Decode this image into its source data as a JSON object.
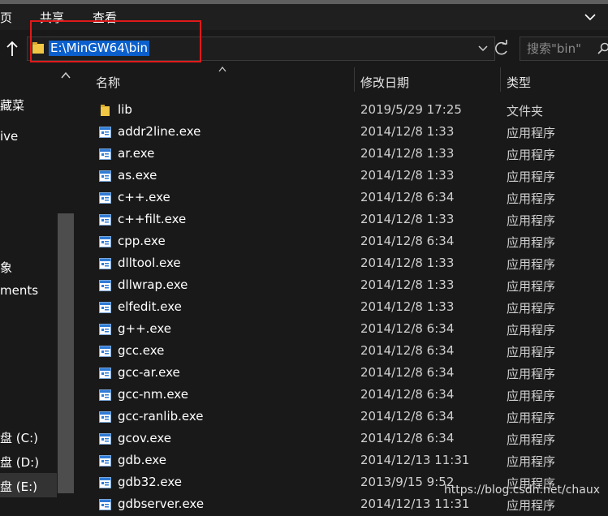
{
  "ribbon": {
    "tabs": [
      "页",
      "共享",
      "查看"
    ]
  },
  "address": {
    "path": "E:\\MinGW64\\bin"
  },
  "search": {
    "placeholder": "搜索\"bin\""
  },
  "nav": {
    "items": [
      "藏菜",
      "ive",
      "象",
      "ments",
      "盘 (C:)",
      "盘 (D:)",
      "盘 (E:)"
    ]
  },
  "columns": {
    "name": "名称",
    "modified": "修改日期",
    "type": "类型"
  },
  "files": [
    {
      "name": "lib",
      "modified": "2019/5/29 17:25",
      "type": "文件夹",
      "icon": "folder-icon"
    },
    {
      "name": "addr2line.exe",
      "modified": "2014/12/8 1:33",
      "type": "应用程序",
      "icon": "exe-icon"
    },
    {
      "name": "ar.exe",
      "modified": "2014/12/8 1:33",
      "type": "应用程序",
      "icon": "exe-icon"
    },
    {
      "name": "as.exe",
      "modified": "2014/12/8 1:33",
      "type": "应用程序",
      "icon": "exe-icon"
    },
    {
      "name": "c++.exe",
      "modified": "2014/12/8 6:34",
      "type": "应用程序",
      "icon": "exe-icon"
    },
    {
      "name": "c++filt.exe",
      "modified": "2014/12/8 1:33",
      "type": "应用程序",
      "icon": "exe-icon"
    },
    {
      "name": "cpp.exe",
      "modified": "2014/12/8 6:34",
      "type": "应用程序",
      "icon": "exe-icon"
    },
    {
      "name": "dlltool.exe",
      "modified": "2014/12/8 1:33",
      "type": "应用程序",
      "icon": "exe-icon"
    },
    {
      "name": "dllwrap.exe",
      "modified": "2014/12/8 1:33",
      "type": "应用程序",
      "icon": "exe-icon"
    },
    {
      "name": "elfedit.exe",
      "modified": "2014/12/8 1:33",
      "type": "应用程序",
      "icon": "exe-icon"
    },
    {
      "name": "g++.exe",
      "modified": "2014/12/8 6:34",
      "type": "应用程序",
      "icon": "exe-icon"
    },
    {
      "name": "gcc.exe",
      "modified": "2014/12/8 6:34",
      "type": "应用程序",
      "icon": "exe-icon"
    },
    {
      "name": "gcc-ar.exe",
      "modified": "2014/12/8 6:34",
      "type": "应用程序",
      "icon": "exe-icon"
    },
    {
      "name": "gcc-nm.exe",
      "modified": "2014/12/8 6:34",
      "type": "应用程序",
      "icon": "exe-icon"
    },
    {
      "name": "gcc-ranlib.exe",
      "modified": "2014/12/8 6:34",
      "type": "应用程序",
      "icon": "exe-icon"
    },
    {
      "name": "gcov.exe",
      "modified": "2014/12/8 6:34",
      "type": "应用程序",
      "icon": "exe-icon"
    },
    {
      "name": "gdb.exe",
      "modified": "2014/12/13 11:31",
      "type": "应用程序",
      "icon": "exe-icon"
    },
    {
      "name": "gdb32.exe",
      "modified": "2013/9/15 9:52",
      "type": "应用程序",
      "icon": "exe-icon"
    },
    {
      "name": "gdbserver.exe",
      "modified": "2014/12/13 11:31",
      "type": "应用程序",
      "icon": "exe-icon"
    }
  ],
  "watermark": "https://blog.csdn.net/chaux",
  "colors": {
    "background": "#191919",
    "selection": "#0b5fcc",
    "highlight_box": "#e01a1a",
    "folder": "#f2c744"
  }
}
